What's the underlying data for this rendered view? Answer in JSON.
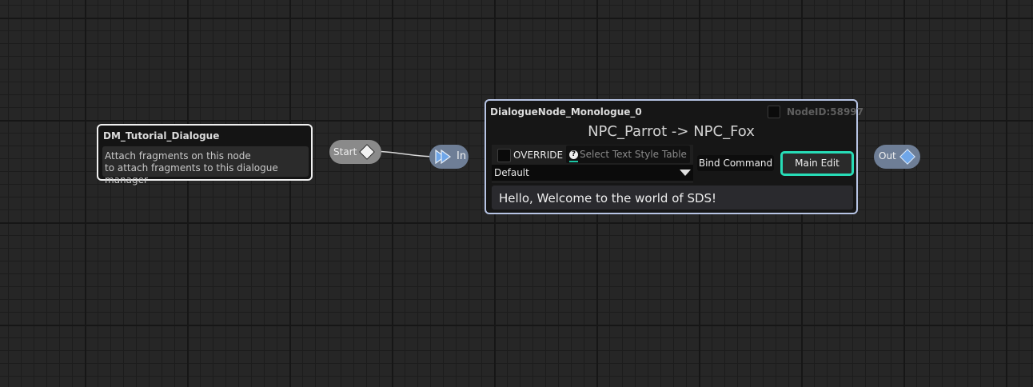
{
  "dm_node": {
    "title": "DM_Tutorial_Dialogue",
    "line1": "Attach fragments on this node",
    "line2": "to attach fragments to this dialogue manager"
  },
  "start_pin": {
    "label": "Start"
  },
  "in_pin": {
    "label": "In"
  },
  "out_pin": {
    "label": "Out"
  },
  "monologue_node": {
    "title": "DialogueNode_Monologue_0",
    "node_id": "NodeID:58997",
    "speaker_line": "NPC_Parrot -> NPC_Fox",
    "override_label": "OVERRIDE",
    "text_style_placeholder": "Select Text Style Table",
    "text_style_value": "Default",
    "bind_command_label": "Bind Command",
    "main_edit_label": "Main Edit",
    "dialogue_text": "Hello, Welcome to the world of SDS!"
  },
  "colors": {
    "main_edit_accent": "#27dcb7",
    "node_border": "#b7c4e4",
    "pin_blue": "#6fa6e8"
  }
}
